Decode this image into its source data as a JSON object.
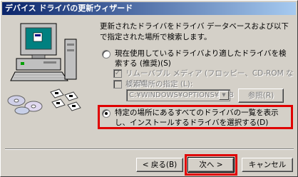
{
  "window": {
    "title": "デバイス ドライバの更新ウィザード"
  },
  "description": "更新されたドライバをドライバ データベースおよび以下で指定された場所で検索します。",
  "options": {
    "search_label": "現在使用しているドライバより適したドライバを検索する (推奨)(S)",
    "removable_label": "リムーバブル メディア (フロッピー、CD-ROM など)(M)",
    "location_label": "検索場所の指定 (L):",
    "location_path": "C:¥WINDOWS¥OPTIONS¥CAB",
    "browse_label": "参照(R)",
    "list_label": "特定の場所にあるすべてのドライバの一覧を表示し、インストールするドライバを選択する(D)"
  },
  "buttons": {
    "back": "< 戻る(B)",
    "next": "次へ >",
    "cancel": "キャンセル"
  },
  "icons": [
    "computer-icon",
    "cd-disc-icon",
    "floppy-disk-icon"
  ],
  "colors": {
    "highlight": "#e00000",
    "titlebar": "#0a246a",
    "face": "#d4d0c8"
  }
}
